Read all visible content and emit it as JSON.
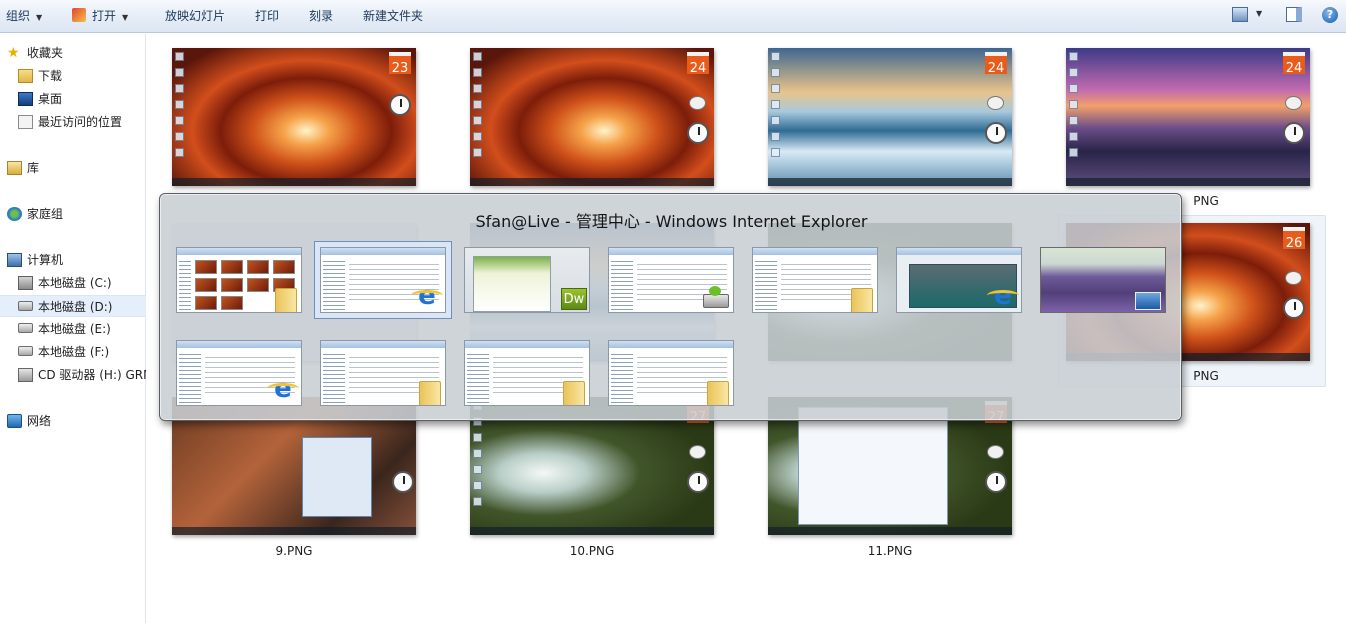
{
  "toolbar": {
    "organize": "组织",
    "open": "打开",
    "slideshow": "放映幻灯片",
    "print": "打印",
    "burn": "刻录",
    "new_folder": "新建文件夹",
    "views_icon": "views-icon",
    "preview_pane_icon": "preview-pane-icon",
    "help_icon": "help-icon"
  },
  "nav": {
    "favorites": {
      "label": "收藏夹",
      "icon": "star-icon"
    },
    "favorites_items": [
      {
        "label": "下载",
        "icon": "downloads-folder-icon"
      },
      {
        "label": "桌面",
        "icon": "desktop-icon"
      },
      {
        "label": "最近访问的位置",
        "icon": "recent-places-icon"
      }
    ],
    "libraries": {
      "label": "库",
      "icon": "library-icon"
    },
    "homegroup": {
      "label": "家庭组",
      "icon": "homegroup-icon"
    },
    "computer": {
      "label": "计算机",
      "icon": "computer-icon"
    },
    "drives": [
      {
        "label": "本地磁盘 (C:)",
        "icon": "system-drive-icon"
      },
      {
        "label": "本地磁盘 (D:)",
        "icon": "drive-icon",
        "selected": true
      },
      {
        "label": "本地磁盘 (E:)",
        "icon": "drive-icon"
      },
      {
        "label": "本地磁盘 (F:)",
        "icon": "drive-icon"
      },
      {
        "label": "CD 驱动器 (H:) GRM",
        "icon": "cd-drive-icon"
      }
    ],
    "network": {
      "label": "网络",
      "icon": "network-icon"
    }
  },
  "files": {
    "row1": [
      {
        "date": "23",
        "caption": ""
      },
      {
        "date": "24",
        "caption": ""
      },
      {
        "date": "24",
        "caption": ""
      },
      {
        "date": "24",
        "caption": "PNG"
      }
    ],
    "row2_right": {
      "date": "26",
      "caption": "PNG"
    },
    "row3": [
      {
        "caption": "9.PNG"
      },
      {
        "date": "27",
        "caption": "10.PNG"
      },
      {
        "date": "27",
        "caption": "11.PNG"
      }
    ]
  },
  "switcher": {
    "title": "Sfan@Live - 管理中心 - Windows Internet Explorer",
    "windows": [
      {
        "app_icon": "folder-icon"
      },
      {
        "app_icon": "ie-icon",
        "active": true
      },
      {
        "app_icon": "dreamweaver-icon",
        "app_badge": "Dw"
      },
      {
        "app_icon": "drive-icon"
      },
      {
        "app_icon": "folder-icon"
      },
      {
        "app_icon": "ie-icon"
      },
      {
        "app_icon": "desktop-preview-icon"
      },
      {
        "app_icon": "ie-icon"
      },
      {
        "app_icon": "folder-icon"
      },
      {
        "app_icon": "folder-icon"
      },
      {
        "app_icon": "folder-icon"
      }
    ]
  }
}
